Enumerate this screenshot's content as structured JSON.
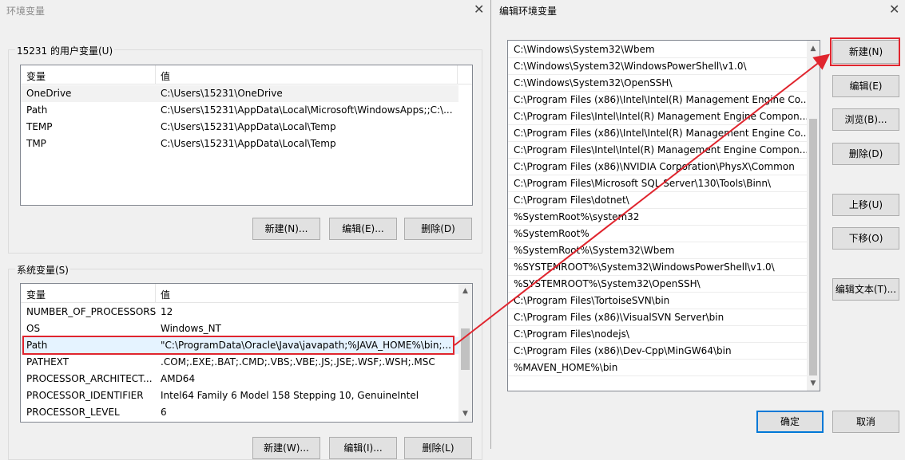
{
  "left_dialog": {
    "title": "环境变量",
    "user_vars": {
      "group_label": "15231 的用户变量(U)",
      "col_var": "变量",
      "col_val": "值",
      "rows": [
        {
          "name": "OneDrive",
          "value": "C:\\Users\\15231\\OneDrive"
        },
        {
          "name": "Path",
          "value": "C:\\Users\\15231\\AppData\\Local\\Microsoft\\WindowsApps;;C:\\..."
        },
        {
          "name": "TEMP",
          "value": "C:\\Users\\15231\\AppData\\Local\\Temp"
        },
        {
          "name": "TMP",
          "value": "C:\\Users\\15231\\AppData\\Local\\Temp"
        }
      ],
      "btn_new": "新建(N)...",
      "btn_edit": "编辑(E)...",
      "btn_delete": "删除(D)"
    },
    "sys_vars": {
      "group_label": "系统变量(S)",
      "col_var": "变量",
      "col_val": "值",
      "rows": [
        {
          "name": "NUMBER_OF_PROCESSORS",
          "value": "12"
        },
        {
          "name": "OS",
          "value": "Windows_NT"
        },
        {
          "name": "Path",
          "value": "\"C:\\ProgramData\\Oracle\\Java\\javapath;%JAVA_HOME%\\bin;..."
        },
        {
          "name": "PATHEXT",
          "value": ".COM;.EXE;.BAT;.CMD;.VBS;.VBE;.JS;.JSE;.WSF;.WSH;.MSC"
        },
        {
          "name": "PROCESSOR_ARCHITECT...",
          "value": "AMD64"
        },
        {
          "name": "PROCESSOR_IDENTIFIER",
          "value": "Intel64 Family 6 Model 158 Stepping 10, GenuineIntel"
        },
        {
          "name": "PROCESSOR_LEVEL",
          "value": "6"
        }
      ],
      "btn_new": "新建(W)...",
      "btn_edit": "编辑(I)...",
      "btn_delete": "删除(L)"
    }
  },
  "right_dialog": {
    "title": "编辑环境变量",
    "items": [
      "C:\\Windows\\System32\\Wbem",
      "C:\\Windows\\System32\\WindowsPowerShell\\v1.0\\",
      "C:\\Windows\\System32\\OpenSSH\\",
      "C:\\Program Files (x86)\\Intel\\Intel(R) Management Engine Co...",
      "C:\\Program Files\\Intel\\Intel(R) Management Engine Compon...",
      "C:\\Program Files (x86)\\Intel\\Intel(R) Management Engine Co...",
      "C:\\Program Files\\Intel\\Intel(R) Management Engine Compon...",
      "C:\\Program Files (x86)\\NVIDIA Corporation\\PhysX\\Common",
      "C:\\Program Files\\Microsoft SQL Server\\130\\Tools\\Binn\\",
      "C:\\Program Files\\dotnet\\",
      "%SystemRoot%\\system32",
      "%SystemRoot%",
      "%SystemRoot%\\System32\\Wbem",
      "%SYSTEMROOT%\\System32\\WindowsPowerShell\\v1.0\\",
      "%SYSTEMROOT%\\System32\\OpenSSH\\",
      "C:\\Program Files\\TortoiseSVN\\bin",
      "C:\\Program Files (x86)\\VisualSVN Server\\bin",
      "C:\\Program Files\\nodejs\\",
      "C:\\Program Files (x86)\\Dev-Cpp\\MinGW64\\bin",
      "%MAVEN_HOME%\\bin"
    ],
    "btn_new": "新建(N)",
    "btn_edit": "编辑(E)",
    "btn_browse": "浏览(B)...",
    "btn_delete": "删除(D)",
    "btn_up": "上移(U)",
    "btn_down": "下移(O)",
    "btn_edit_text": "编辑文本(T)...",
    "btn_ok": "确定",
    "btn_cancel": "取消"
  },
  "colors": {
    "annotation": "#e0252e",
    "selection": "#e5f3ff",
    "accent": "#0078d7"
  },
  "icons": [
    "close-icon",
    "scroll-up-icon",
    "scroll-down-icon"
  ]
}
